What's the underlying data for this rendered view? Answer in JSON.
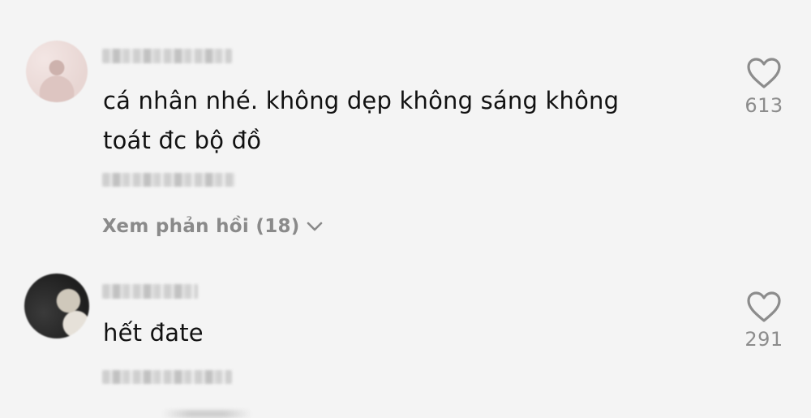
{
  "comments": [
    {
      "text_line1": "cá nhân nhé. không dẹp không sáng không",
      "text_line2": "toát đc bộ đồ",
      "likes": "613",
      "reply_label": "Xem phản hồi (18)"
    },
    {
      "text_line1": "hết đate",
      "likes": "291"
    }
  ],
  "icons": {
    "like": "heart-outline-icon",
    "expand": "chevron-down-icon"
  },
  "colors": {
    "background": "#f4f4f4",
    "text": "#111111",
    "muted": "#8a8a8a"
  }
}
